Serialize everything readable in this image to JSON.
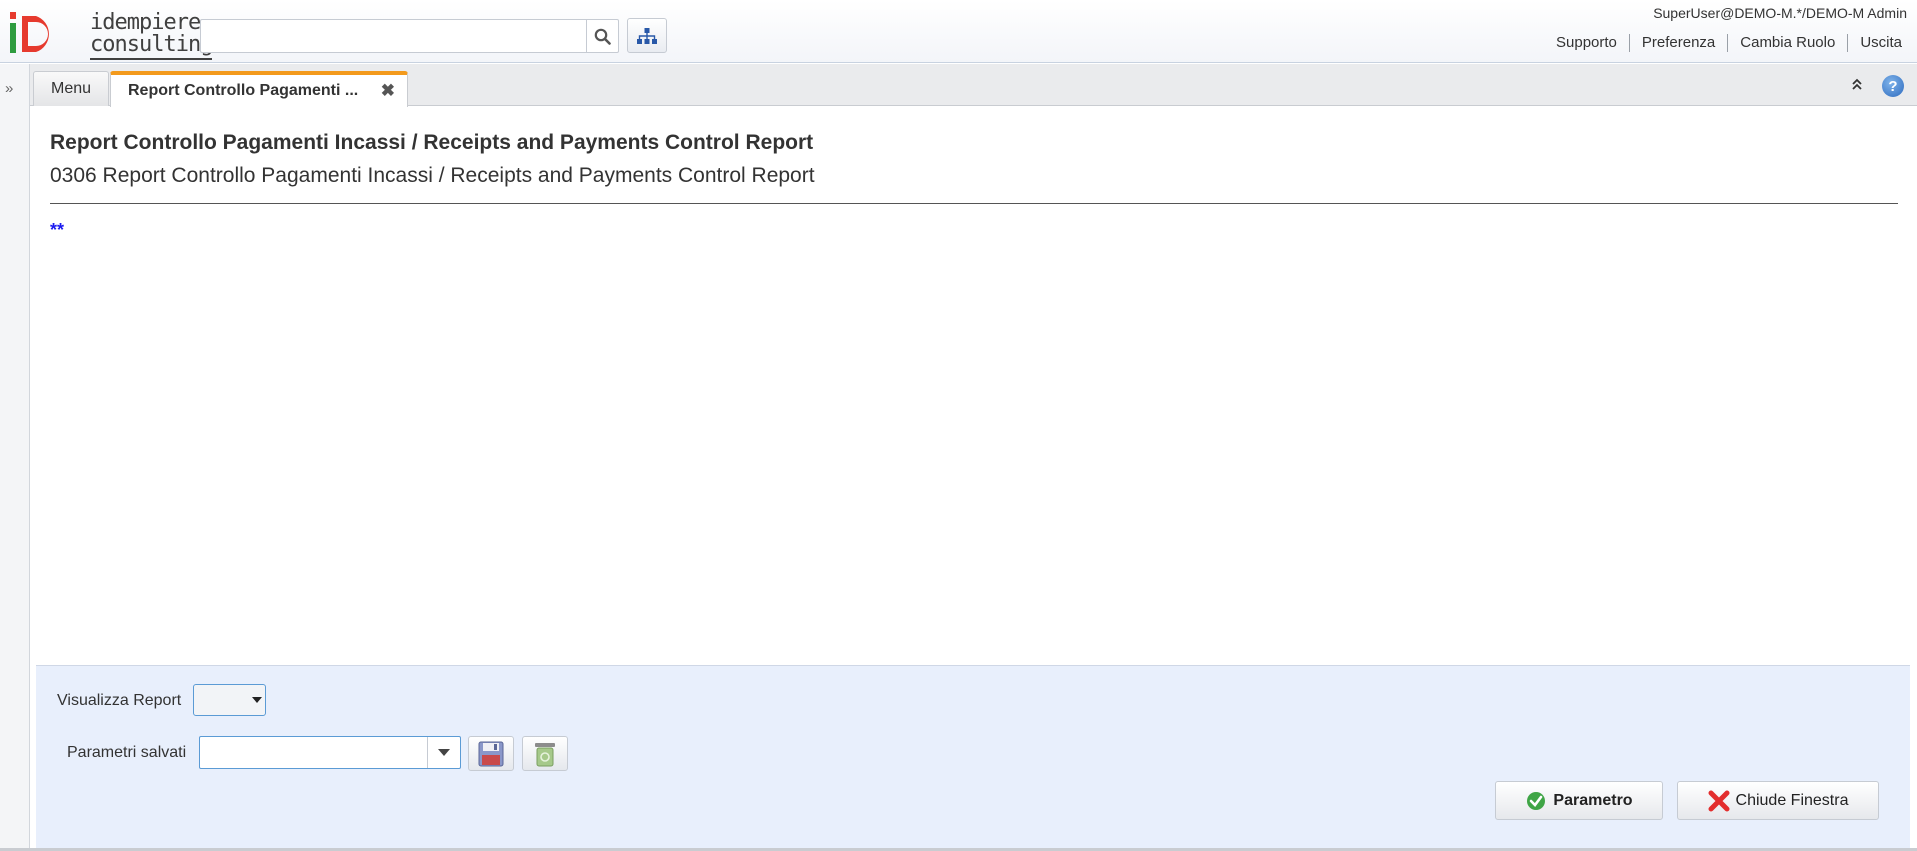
{
  "header": {
    "logo_line1": "idempiere",
    "logo_line2": "consulting",
    "search_value": "",
    "user_info": "SuperUser@DEMO-M.*/DEMO-M Admin",
    "links": [
      "Supporto",
      "Preferenza",
      "Cambia Ruolo",
      "Uscita"
    ]
  },
  "tabs": {
    "menu_label": "Menu",
    "active_label": "Report Controllo Pagamenti ...",
    "close_glyph": "✖",
    "collapse_glyph": "»",
    "help_glyph": "?"
  },
  "content": {
    "title": "Report Controllo Pagamenti Incassi / Receipts and Payments Control Report",
    "subtitle": "0306 Report Controllo Pagamenti Incassi / Receipts and Payments Control Report",
    "description": "**"
  },
  "params": {
    "report_label": "Visualizza Report",
    "report_value": "",
    "saved_label": "Parametri salvati",
    "saved_value": "",
    "param_button": "Parametro",
    "close_button": "Chiude Finestra"
  },
  "icons": {
    "search": "search-icon",
    "tree": "sitemap-icon",
    "expand": "double-chevron-right-icon",
    "collapse": "double-chevron-up-icon",
    "help": "help-icon",
    "save": "save-icon",
    "delete": "trash-icon",
    "ok": "green-check-icon",
    "cancel": "red-x-icon"
  },
  "colors": {
    "accent_tab": "#f39a1c",
    "panel_bg": "#e8effc",
    "description_text": "#1a1af0"
  }
}
